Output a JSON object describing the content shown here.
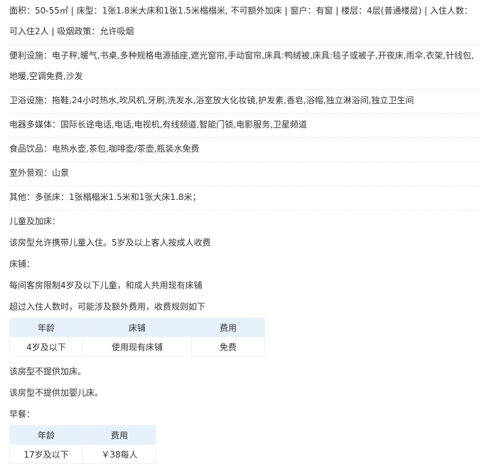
{
  "room_info": {
    "area_label": "面积：",
    "area_value": "50-55㎡",
    "bed_label": "床型：",
    "bed_value": "1张1.8米大床和1张1.5米榻榻米, 不可额外加床",
    "window_label": "窗户：",
    "window_value": "有窗",
    "floor_label": "楼层：",
    "floor_value": "4层(普通楼层)",
    "occupancy_label": "入住人数：",
    "occupancy_value": "可入住2人",
    "smoking_label": "吸烟政策：",
    "smoking_value": "允许吸烟"
  },
  "facilities": [
    {
      "label": "便利设施：",
      "value": "电子秤,暖气,书桌,多种规格电源插座,遮光窗帘,手动窗帘,床具:鸭绒被,床具:毯子或被子,开夜床,雨伞,衣架,针线包,地暖,空调免费,沙发"
    },
    {
      "label": "卫浴设施：",
      "value": "拖鞋,24小时热水,吹风机,牙刷,洗发水,浴室放大化妆镜,护发素,香皂,浴帽,独立淋浴间,独立卫生间"
    },
    {
      "label": "电器多媒体：",
      "value": "国际长途电话,电话,电视机,有线频道,智能门锁,电影服务,卫星频道"
    },
    {
      "label": "食品饮品：",
      "value": "电热水壶,茶包,咖啡壶/茶壶,瓶装水免费"
    },
    {
      "label": "室外景观：",
      "value": "山景"
    },
    {
      "label": "其他：",
      "value": "多张床：1张榻榻米1.5米和1张大床1.8米；"
    }
  ],
  "children_policy": {
    "title": "儿童及加床：",
    "allow_text": "该房型允许携带儿童入住。5岁及以上客人按成人收费",
    "bed_title": "床铺：",
    "bed_limit": "每间客房限制4岁及以下儿童，和成人共用现有床铺",
    "overflow_note": "超过入住人数时，可能涉及额外费用，收费规则如下",
    "table": {
      "headers": [
        "年龄",
        "床铺",
        "费用"
      ],
      "rows": [
        [
          "4岁及以下",
          "使用现有床铺",
          "免费"
        ]
      ]
    },
    "no_extra_bed": "该房型不提供加床。",
    "no_crib": "该房型不提供加婴儿床。"
  },
  "breakfast": {
    "title": "早餐：",
    "table": {
      "headers": [
        "年龄",
        "费用"
      ],
      "rows": [
        [
          "17岁及以下",
          "￥38每人"
        ]
      ]
    }
  },
  "colors": {
    "table_header_bg": "#e6f1fb",
    "free_link": "#2577e3"
  }
}
